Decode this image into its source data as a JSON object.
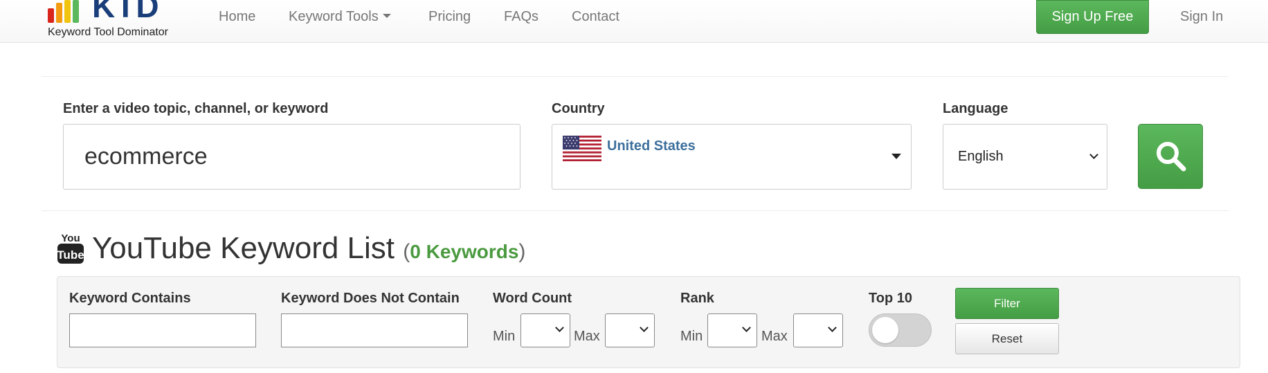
{
  "brand": {
    "logo_text": "KTD",
    "logo_sub": "Keyword Tool Dominator",
    "colors": {
      "logo_blue": "#1a3e7a",
      "accent_green": "#4cae4c",
      "link_blue": "#3c6f9c"
    }
  },
  "nav": {
    "items": [
      {
        "label": "Home"
      },
      {
        "label": "Keyword Tools"
      },
      {
        "label": "Pricing"
      },
      {
        "label": "FAQs"
      },
      {
        "label": "Contact"
      }
    ],
    "signup_label": "Sign Up Free",
    "signin_label": "Sign In"
  },
  "search": {
    "topic_label": "Enter a video topic, channel, or keyword",
    "topic_value": "ecommerce",
    "country_label": "Country",
    "country_value": "United States",
    "country_flag_icon": "us-flag-icon",
    "language_label": "Language",
    "language_value": "English",
    "submit_icon": "search-icon"
  },
  "list": {
    "icon": "youtube-icon",
    "youtube_icon_text_top": "You",
    "youtube_icon_text_bottom": "Tube",
    "title": "YouTube Keyword List",
    "paren_open": "(",
    "count_text": "0 Keywords",
    "paren_close": ")"
  },
  "filters": {
    "contains_label": "Keyword Contains",
    "contains_value": "",
    "not_contains_label": "Keyword Does Not Contain",
    "not_contains_value": "",
    "word_count_label": "Word Count",
    "rank_label": "Rank",
    "min_label": "Min",
    "max_label": "Max",
    "top10_label": "Top 10",
    "top10_on": false,
    "filter_button": "Filter",
    "reset_button": "Reset"
  }
}
